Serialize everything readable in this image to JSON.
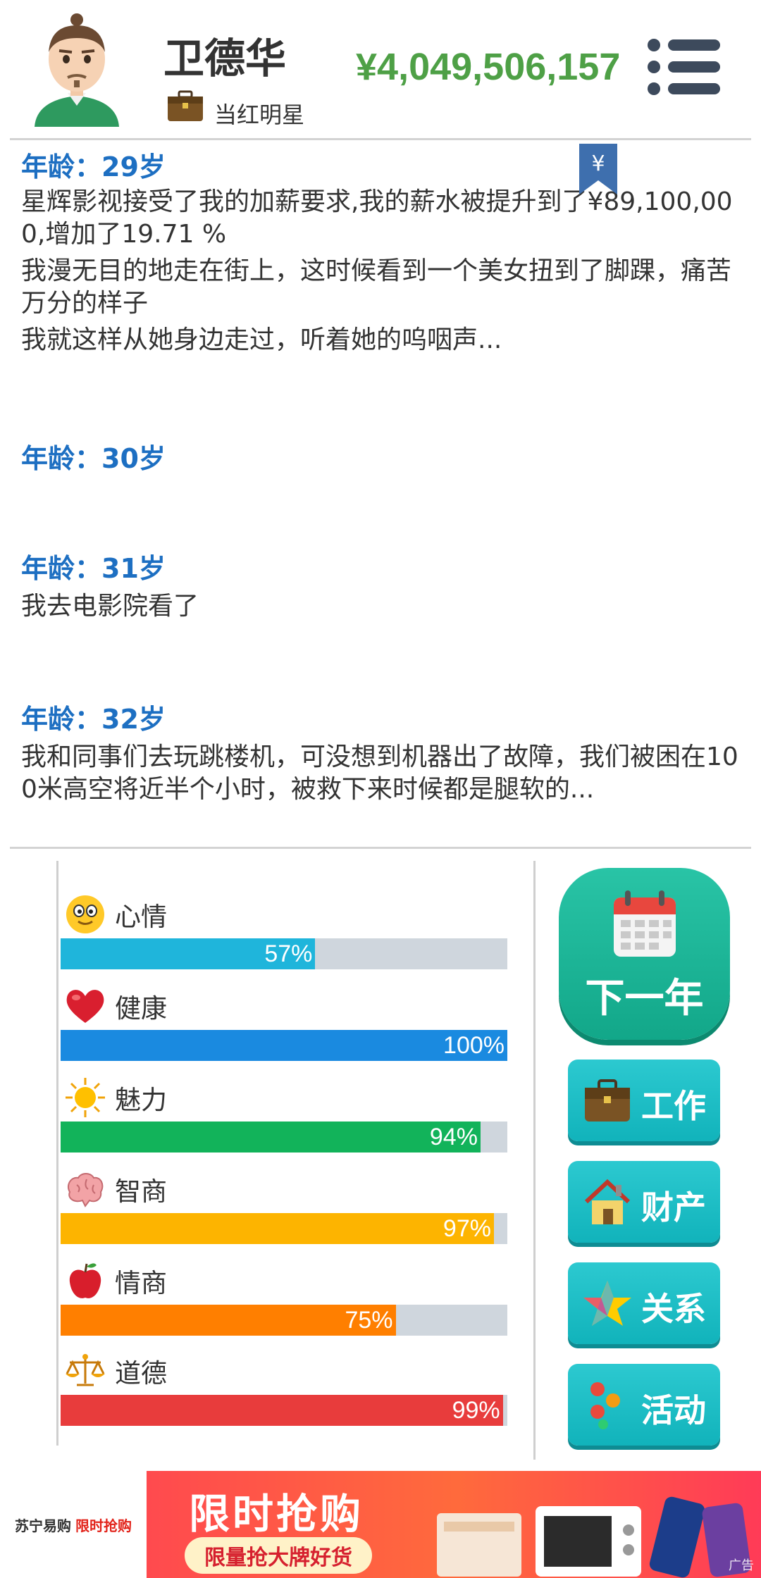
{
  "header": {
    "name": "卫德华",
    "job": "当红明星",
    "money": "¥4,049,506,157"
  },
  "log": [
    {
      "age": "年龄：29岁",
      "lines": [
        "星辉影视接受了我的加薪要求,我的薪水被提升到了¥89,100,000,增加了19.71 %",
        "我漫无目的地走在街上，这时候看到一个美女扭到了脚踝，痛苦万分的样子",
        "我就这样从她身边走过，听着她的呜咽声..."
      ]
    },
    {
      "age": "年龄：30岁",
      "lines": []
    },
    {
      "age": "年龄：31岁",
      "lines": [
        "我去电影院看了"
      ]
    },
    {
      "age": "年龄：32岁",
      "lines": [
        "我和同事们去玩跳楼机，可没想到机器出了故障，我们被困在100米高空将近半个小时，被救下来时候都是腿软的..."
      ]
    }
  ],
  "bookmark_glyph": "¥",
  "stats": [
    {
      "label": "心情",
      "value": 57,
      "display": "57%",
      "color": "#1fb5db",
      "icon": "smiley-icon"
    },
    {
      "label": "健康",
      "value": 100,
      "display": "100%",
      "color": "#1a8ae0",
      "icon": "heart-icon"
    },
    {
      "label": "魅力",
      "value": 94,
      "display": "94%",
      "color": "#12b35a",
      "icon": "sun-icon"
    },
    {
      "label": "智商",
      "value": 97,
      "display": "97%",
      "color": "#fdb400",
      "icon": "brain-icon"
    },
    {
      "label": "情商",
      "value": 75,
      "display": "75%",
      "color": "#ff7f00",
      "icon": "apple-icon"
    },
    {
      "label": "道德",
      "value": 99,
      "display": "99%",
      "color": "#e83c3c",
      "icon": "scales-icon"
    }
  ],
  "actions": {
    "next_year": "下一年",
    "work": "工作",
    "property": "财产",
    "relations": "关系",
    "activities": "活动"
  },
  "ad": {
    "brand": "苏宁易购",
    "tag": "限时抢购",
    "title": "限时抢购",
    "subtitle": "限量抢大牌好货",
    "mark": "广告"
  }
}
